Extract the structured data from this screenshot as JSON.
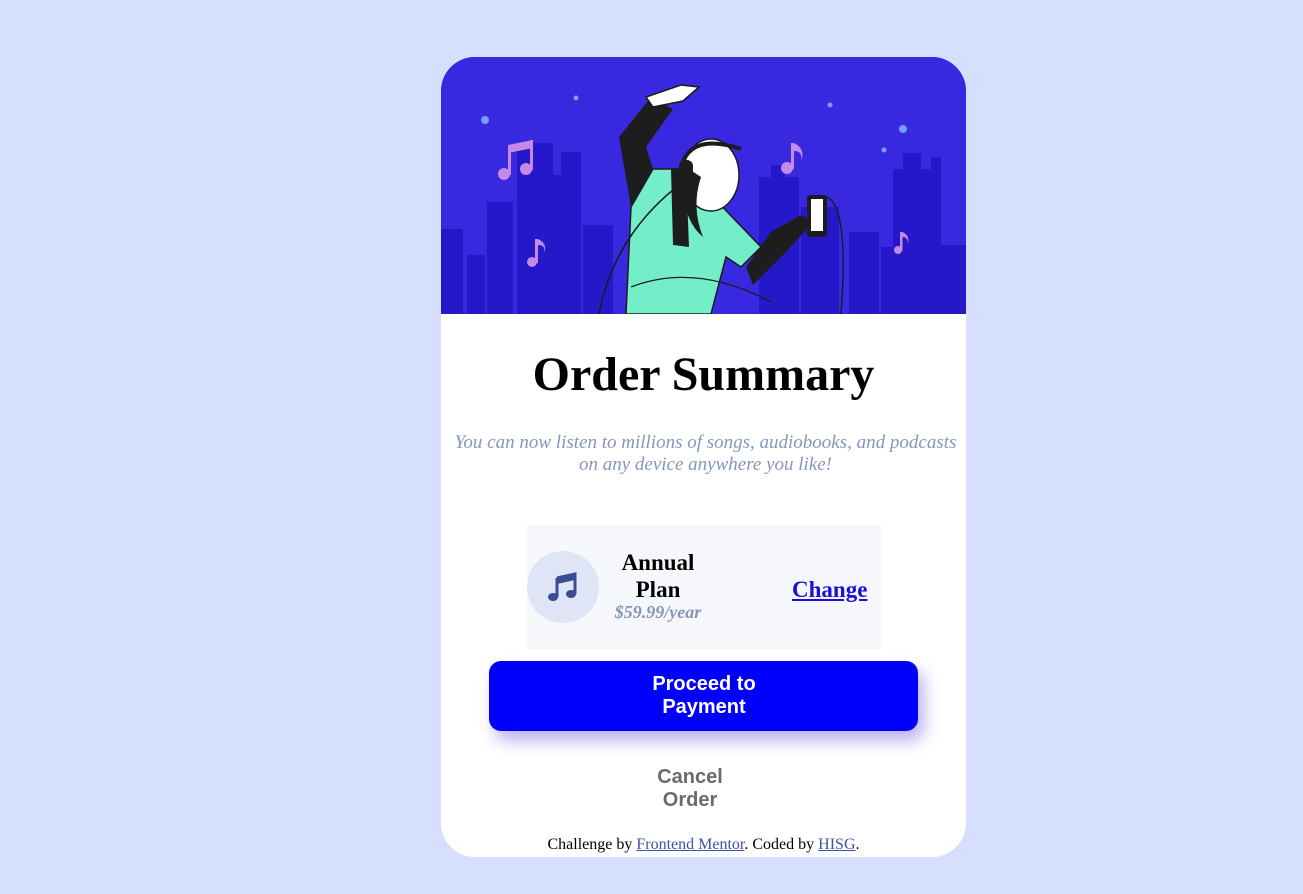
{
  "order": {
    "title": "Order Summary",
    "description": "You can now listen to millions of songs, audiobooks, and podcasts on any device anywhere you like!",
    "plan": {
      "name": "Annual Plan",
      "price": "$59.99/year",
      "change_label": "Change",
      "icon": "music-note-icon"
    },
    "proceed_label": "Proceed to Payment",
    "cancel_label": "Cancel Order"
  },
  "attribution": {
    "prefix": "Challenge by ",
    "challenge_link": "Frontend Mentor",
    "middle": ". Coded by ",
    "author_link": "HISG",
    "suffix": "."
  },
  "colors": {
    "page_background": "#d6e0fe",
    "hero_background": "#3828e0",
    "primary_button": "#0000ff",
    "muted_text": "#8696b8",
    "link": "#1a0fd9"
  }
}
